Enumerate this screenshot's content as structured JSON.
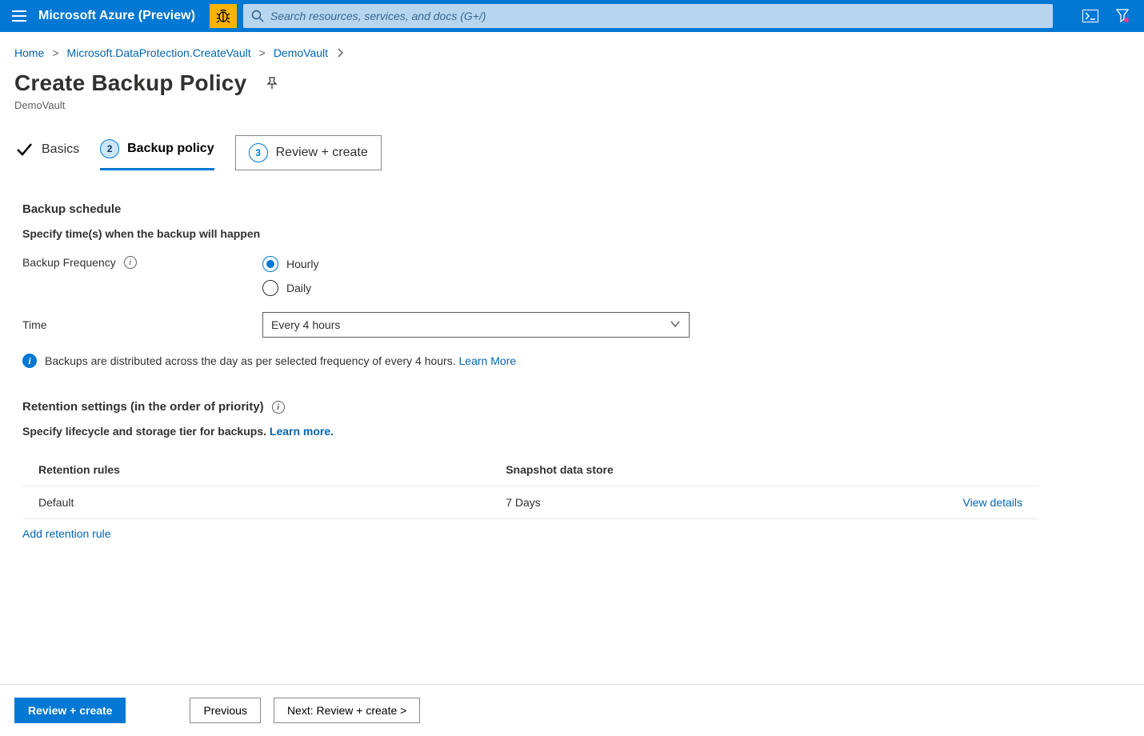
{
  "topbar": {
    "brand": "Microsoft Azure (Preview)",
    "search_placeholder": "Search resources, services, and docs (G+/)"
  },
  "breadcrumb": {
    "items": [
      "Home",
      "Microsoft.DataProtection.CreateVault",
      "DemoVault"
    ]
  },
  "page": {
    "title": "Create Backup Policy",
    "subtitle": "DemoVault"
  },
  "tabs": {
    "basics": "Basics",
    "policy": {
      "num": "2",
      "label": "Backup policy"
    },
    "review": {
      "num": "3",
      "label": "Review + create"
    }
  },
  "schedule": {
    "section_title": "Backup schedule",
    "section_sub": "Specify time(s) when the backup will happen",
    "freq_label": "Backup Frequency",
    "freq_options": {
      "hourly": "Hourly",
      "daily": "Daily"
    },
    "freq_selected": "hourly",
    "time_label": "Time",
    "time_value": "Every 4 hours",
    "info_text": "Backups are distributed across the day as per selected frequency of every 4 hours.",
    "info_link": "Learn More"
  },
  "retention": {
    "section_title": "Retention settings (in the order of priority)",
    "section_sub_prefix": "Specify lifecycle and storage tier for backups.",
    "section_sub_link": "Learn more.",
    "columns": {
      "rules": "Retention rules",
      "snapshot": "Snapshot data store"
    },
    "rows": [
      {
        "rule": "Default",
        "snapshot": "7 Days",
        "action": "View details"
      }
    ],
    "add_link": "Add retention rule"
  },
  "footer": {
    "primary": "Review + create",
    "previous": "Previous",
    "next": "Next: Review + create >"
  }
}
